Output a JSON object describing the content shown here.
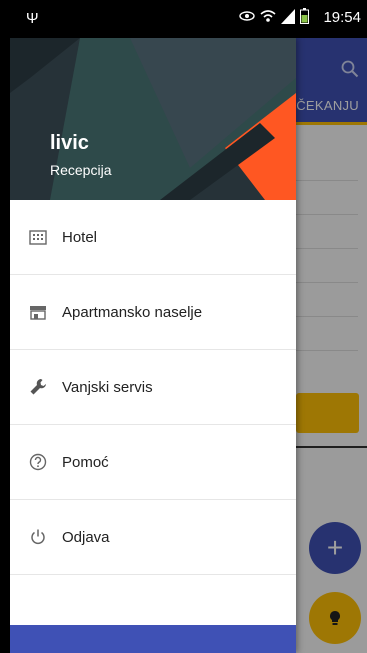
{
  "status_bar": {
    "time": "19:54"
  },
  "background_app": {
    "tab_partial": "ČEKANJU"
  },
  "drawer": {
    "user_name": "livic",
    "user_role": "Recepcija",
    "items": [
      {
        "label": "Hotel",
        "icon": "building-icon"
      },
      {
        "label": "Apartmansko naselje",
        "icon": "store-icon"
      },
      {
        "label": "Vanjski servis",
        "icon": "wrench-icon"
      },
      {
        "label": "Pomoć",
        "icon": "help-icon"
      },
      {
        "label": "Odjava",
        "icon": "power-icon"
      }
    ]
  },
  "colors": {
    "primary": "#3f51b5",
    "accent": "#ffc107",
    "header_dark": "#263238",
    "header_mid": "#37474f",
    "header_orange": "#ff5722"
  }
}
